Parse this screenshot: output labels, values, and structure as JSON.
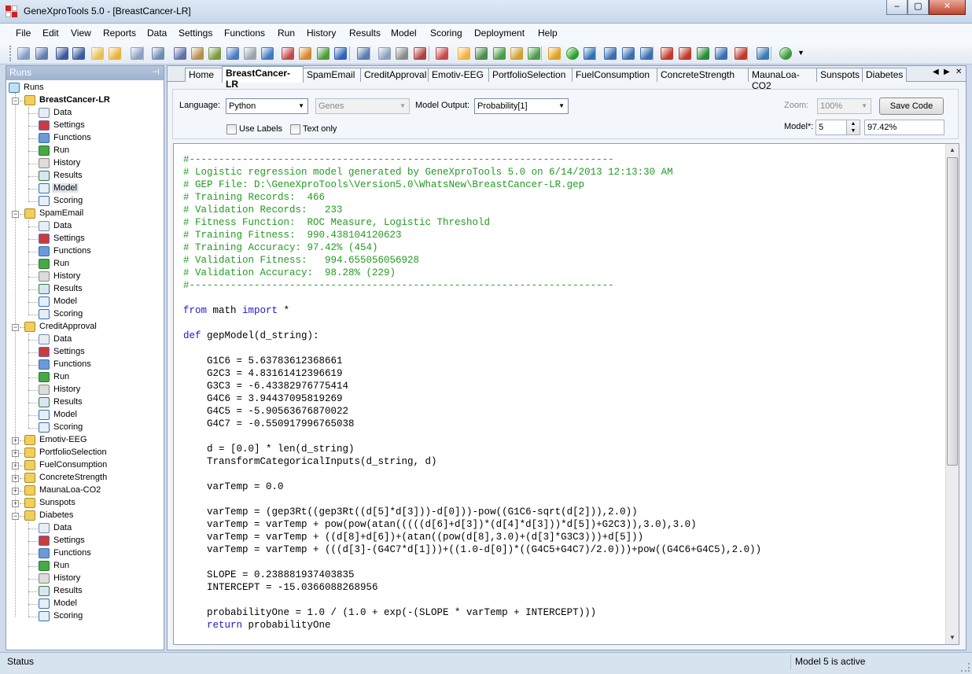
{
  "window": {
    "title": "GeneXproTools 5.0 - [BreastCancer-LR]",
    "minimize": "–",
    "maximize": "▢",
    "close": "✕"
  },
  "menu": [
    "File",
    "Edit",
    "View",
    "Reports",
    "Data",
    "Settings",
    "Functions",
    "Run",
    "History",
    "Results",
    "Model",
    "Scoring",
    "Deployment",
    "Help"
  ],
  "toolbar": {
    "more": "▼",
    "icons": [
      "new-icon",
      "open-icon",
      "save-icon",
      "save-all-icon",
      "folder-icon",
      "folder-open-icon",
      "copy-icon",
      "preview-icon",
      "cube-icon",
      "scales-icon",
      "paint-icon",
      "copy-blocks-icon",
      "ring-icon",
      "layers-icon",
      "molecule-icon",
      "arrow-icon",
      "blocks-icon",
      "shield-icon",
      "spark-icon",
      "page-icon",
      "gear-icon",
      "pen-icon",
      "wrench-icon",
      "palette-icon",
      "grid-icon",
      "chart-icon",
      "table-icon",
      "line-chart-icon",
      "brush-icon",
      "add-icon",
      "network-icon",
      "tree-icon",
      "tree-alt-icon",
      "list-icon",
      "formula-icon",
      "formula-c-icon",
      "formula-g-icon",
      "formula-j-icon",
      "formula-s-icon",
      "calculator-icon",
      "help-icon"
    ]
  },
  "tree": {
    "header": "Runs",
    "pin": "📌",
    "root": "Runs",
    "expanded_glyph": "−",
    "collapsed_glyph": "+",
    "children_labels": [
      "Data",
      "Settings",
      "Functions",
      "Run",
      "History",
      "Results",
      "Model",
      "Scoring"
    ],
    "runs": [
      {
        "name": "BreastCancer-LR",
        "expanded": true,
        "bold": true,
        "selected_child": "Model"
      },
      {
        "name": "SpamEmail",
        "expanded": true
      },
      {
        "name": "CreditApproval",
        "expanded": true
      },
      {
        "name": "Emotiv-EEG",
        "expanded": false
      },
      {
        "name": "PortfolioSelection",
        "expanded": false
      },
      {
        "name": "FuelConsumption",
        "expanded": false
      },
      {
        "name": "ConcreteStrength",
        "expanded": false
      },
      {
        "name": "MaunaLoa-CO2",
        "expanded": false
      },
      {
        "name": "Sunspots",
        "expanded": false
      },
      {
        "name": "Diabetes",
        "expanded": true
      }
    ]
  },
  "tabs": {
    "items": [
      "Home",
      "BreastCancer-LR",
      "SpamEmail",
      "CreditApproval",
      "Emotiv-EEG",
      "PortfolioSelection",
      "FuelConsumption",
      "ConcreteStrength",
      "MaunaLoa-CO2",
      "Sunspots",
      "Diabetes"
    ],
    "active": "BreastCancer-LR",
    "prev": "◀",
    "next": "▶",
    "close": "✕"
  },
  "options": {
    "language_label": "Language:",
    "language_value": "Python",
    "genes_value": "Genes",
    "model_output_label": "Model Output:",
    "model_output_value": "Probability[1]",
    "use_labels": "Use Labels",
    "text_only": "Text only",
    "zoom_label": "Zoom:",
    "zoom_value": "100%",
    "save_code": "Save Code",
    "model_label": "Model*:",
    "model_value": "5",
    "accuracy_value": "97.42%",
    "combo_arrow": "▼",
    "spin_up": "▲",
    "spin_down": "▼"
  },
  "code": [
    {
      "t": "c",
      "s": "#------------------------------------------------------------------------"
    },
    {
      "t": "c",
      "s": "# Logistic regression model generated by GeneXproTools 5.0 on 6/14/2013 12:13:30 AM"
    },
    {
      "t": "c",
      "s": "# GEP File: D:\\GeneXproTools\\Version5.0\\WhatsNew\\BreastCancer-LR.gep"
    },
    {
      "t": "c",
      "s": "# Training Records:  466"
    },
    {
      "t": "c",
      "s": "# Validation Records:   233"
    },
    {
      "t": "c",
      "s": "# Fitness Function:  ROC Measure, Logistic Threshold"
    },
    {
      "t": "c",
      "s": "# Training Fitness:  990.438104120623"
    },
    {
      "t": "c",
      "s": "# Training Accuracy: 97.42% (454)"
    },
    {
      "t": "c",
      "s": "# Validation Fitness:   994.655056056928"
    },
    {
      "t": "c",
      "s": "# Validation Accuracy:  98.28% (229)"
    },
    {
      "t": "c",
      "s": "#------------------------------------------------------------------------"
    },
    {
      "t": "n",
      "s": ""
    },
    {
      "t": "k",
      "k1": "from",
      "m": " math ",
      "k2": "import",
      "e": " *"
    },
    {
      "t": "n",
      "s": ""
    },
    {
      "t": "k",
      "k1": "def",
      "m": " gepModel(d_string):",
      "k2": "",
      "e": ""
    },
    {
      "t": "n",
      "s": ""
    },
    {
      "t": "n",
      "s": "    G1C6 = 5.63783612368661"
    },
    {
      "t": "n",
      "s": "    G2C3 = 4.83161412396619"
    },
    {
      "t": "n",
      "s": "    G3C3 = -6.43382976775414"
    },
    {
      "t": "n",
      "s": "    G4C6 = 3.94437095819269"
    },
    {
      "t": "n",
      "s": "    G4C5 = -5.90563676870022"
    },
    {
      "t": "n",
      "s": "    G4C7 = -0.550917996765038"
    },
    {
      "t": "n",
      "s": ""
    },
    {
      "t": "n",
      "s": "    d = [0.0] * len(d_string)"
    },
    {
      "t": "n",
      "s": "    TransformCategoricalInputs(d_string, d)"
    },
    {
      "t": "n",
      "s": ""
    },
    {
      "t": "n",
      "s": "    varTemp = 0.0"
    },
    {
      "t": "n",
      "s": ""
    },
    {
      "t": "n",
      "s": "    varTemp = (gep3Rt((gep3Rt((d[5]*d[3]))-d[0]))-pow((G1C6-sqrt(d[2])),2.0))"
    },
    {
      "t": "n",
      "s": "    varTemp = varTemp + pow(pow(atan(((((d[6]+d[3])*(d[4]*d[3]))*d[5])+G2C3)),3.0),3.0)"
    },
    {
      "t": "n",
      "s": "    varTemp = varTemp + ((d[8]+d[6])+(atan((pow(d[8],3.0)+(d[3]*G3C3)))+d[5]))"
    },
    {
      "t": "n",
      "s": "    varTemp = varTemp + (((d[3]-(G4C7*d[1]))+((1.0-d[0])*((G4C5+G4C7)/2.0)))+pow((G4C6+G4C5),2.0))"
    },
    {
      "t": "n",
      "s": ""
    },
    {
      "t": "n",
      "s": "    SLOPE = 0.238881937403835"
    },
    {
      "t": "n",
      "s": "    INTERCEPT = -15.0366088268956"
    },
    {
      "t": "n",
      "s": ""
    },
    {
      "t": "n",
      "s": "    probabilityOne = 1.0 / (1.0 + exp(-(SLOPE * varTemp + INTERCEPT)))"
    },
    {
      "t": "k",
      "k1": "    return",
      "m": " probabilityOne",
      "k2": "",
      "e": ""
    }
  ],
  "scroll": {
    "up": "▲",
    "down": "▼"
  },
  "status": {
    "left": "Status",
    "right": "Model 5 is active"
  },
  "colors": {
    "comment": "#219b21",
    "keyword": "#1a1ac8",
    "titlebar": "#c6d6ea",
    "folder": "#f2cf5b"
  }
}
